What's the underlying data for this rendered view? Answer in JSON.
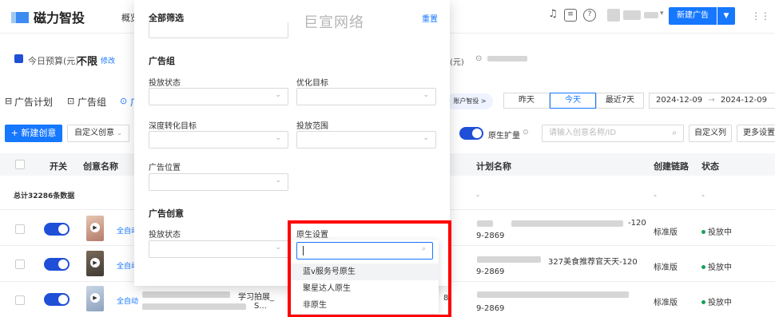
{
  "header": {
    "brand": "磁力智投",
    "nav_overview": "概览",
    "new_ad_button": "新建广告",
    "new_ad_drop": "▼",
    "dots": "⋮⋮"
  },
  "budget": {
    "label": "今日预算(元)",
    "value": "不限",
    "edit": "修改",
    "right_label": "(元)"
  },
  "tabs": [
    "广告计划",
    "广告组",
    "广"
  ],
  "toolbar": {
    "new_creative": "+ 新建创意",
    "custom_creative": "自定义创意",
    "native_expand": "原生扩量",
    "search_placeholder": "请输入创意名称/ID",
    "custom_columns": "自定义列",
    "more_settings": "更多设置"
  },
  "account_btn": "账户智投 >",
  "date_filter": {
    "yesterday": "昨天",
    "today": "今天",
    "last7": "最近7天",
    "start": "2024-12-09",
    "arrow": "→",
    "end": "2024-12-09"
  },
  "table": {
    "headers": {
      "switch": "开关",
      "creative_name": "创意名称",
      "plan_name": "计划名称",
      "chain": "创建链路",
      "status": "状态"
    },
    "total": "总计32286条数据",
    "total_dash_plan": "-",
    "total_dash_chain": "-",
    "total_dash_status": "-",
    "rows": [
      {
        "auto": "全自动",
        "plan_tail": "-120",
        "plan_line2": "9-2869",
        "chain": "标准版",
        "status": "投放中"
      },
      {
        "auto": "全自动",
        "plan_tail": "327美食推荐官天天-120",
        "plan_line2": "9-2869",
        "chain": "标准版",
        "status": "投放中"
      },
      {
        "auto": "全自动",
        "name_tail": "学习拍展_",
        "name_tail2": "S...",
        "plan_line2": "9-2869",
        "chain": "标准版",
        "status": "投放中",
        "extra": "8"
      }
    ]
  },
  "panel": {
    "title": "全部筛选",
    "reset": "重置",
    "watermark": "巨宣网络",
    "section_adgroup": "广告组",
    "label_delivery_status": "投放状态",
    "label_optimize_target": "优化目标",
    "label_deep_target": "深度转化目标",
    "label_delivery_range": "投放范围",
    "label_ad_position": "广告位置",
    "section_creative": "广告创意",
    "label_creative_status": "投放状态",
    "label_native": "原生设置"
  },
  "dropdown": {
    "options": [
      "蓝v服务号原生",
      "聚星达人原生",
      "非原生"
    ]
  }
}
